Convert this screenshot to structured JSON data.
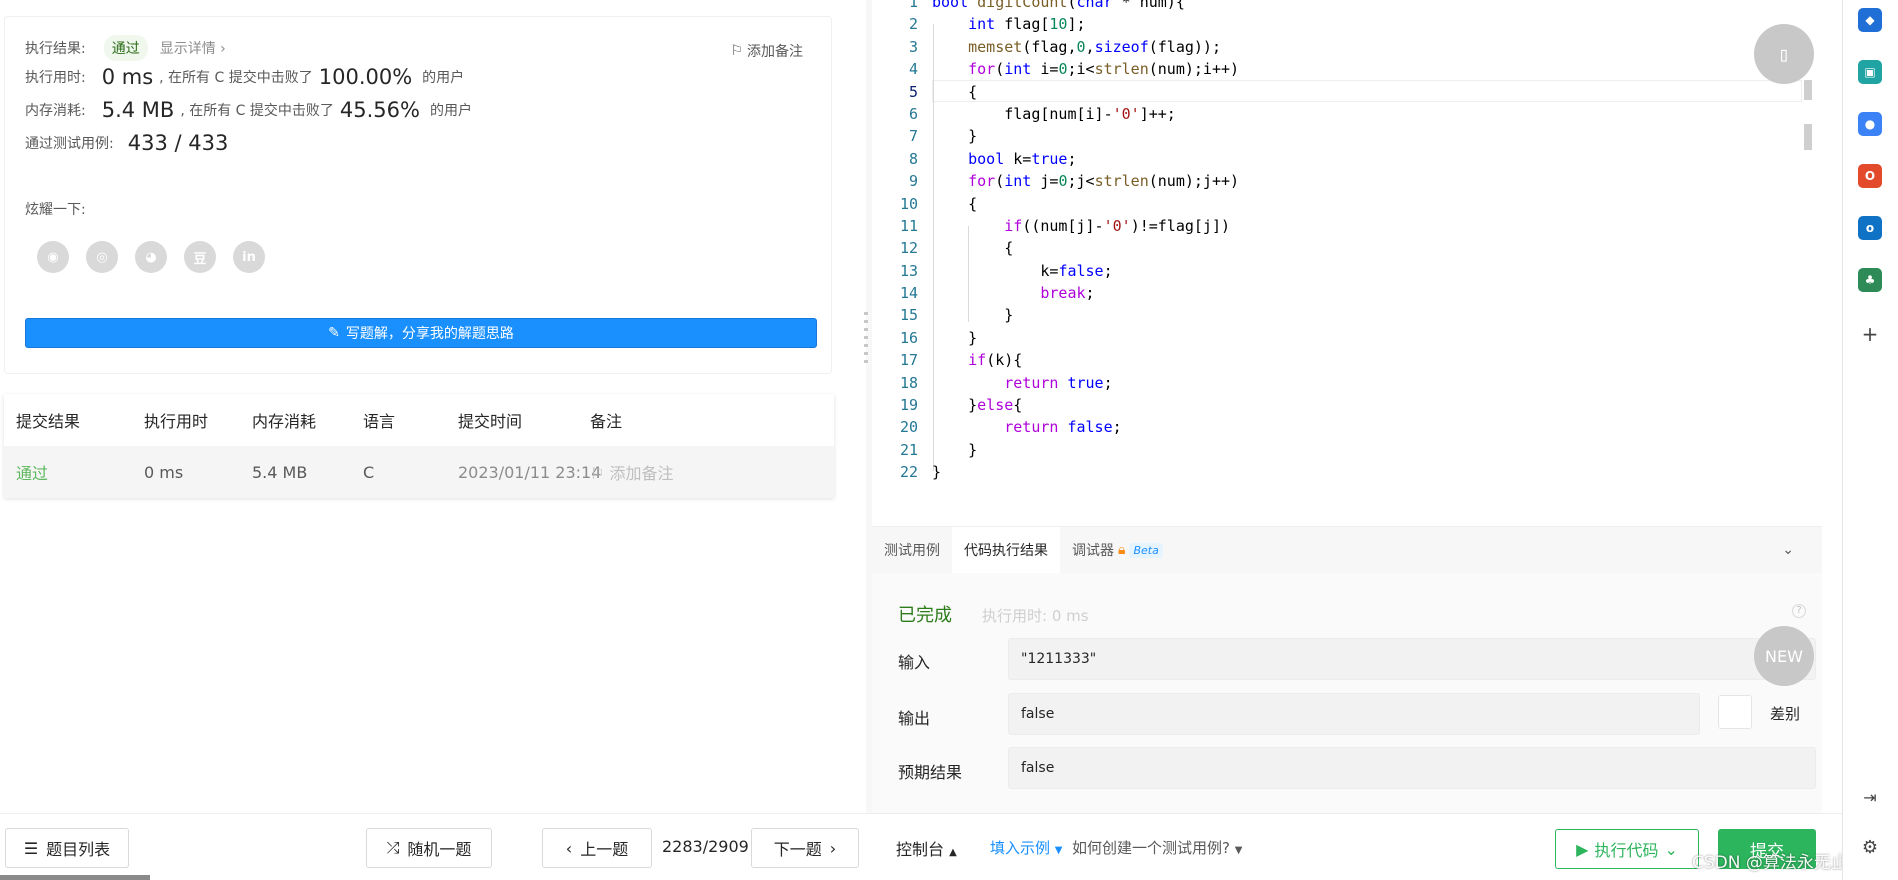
{
  "result": {
    "exec_label": "执行结果:",
    "status": "通过",
    "details": "显示详情 ›",
    "add_note": "添加备注",
    "time_label": "执行用时:",
    "time_value": "0 ms",
    "beat_prefix": ", 在所有 C 提交中击败了",
    "time_percent": "100.00%",
    "users_suffix": "的用户",
    "mem_label": "内存消耗:",
    "mem_value": "5.4 MB",
    "mem_percent": "45.56%",
    "cases_label": "通过测试用例:",
    "cases_value": "433 / 433",
    "share_label": "炫耀一下:",
    "share_icons": [
      "wechat-icon",
      "weibo-icon",
      "qq-icon",
      "douban-icon",
      "linkedin-icon"
    ],
    "share_glyphs": [
      "◉",
      "◎",
      "◕",
      "豆",
      "in"
    ],
    "write_solution": "写题解，分享我的解题思路"
  },
  "submissions": {
    "headers": [
      "提交结果",
      "执行用时",
      "内存消耗",
      "语言",
      "提交时间",
      "备注"
    ],
    "row": {
      "status": "通过",
      "time": "0 ms",
      "memory": "5.4 MB",
      "language": "C",
      "submitted": "2023/01/11 23:14",
      "note": "添加备注"
    }
  },
  "editor": {
    "line_numbers": [
      "1",
      "2",
      "3",
      "4",
      "5",
      "6",
      "7",
      "8",
      "9",
      "10",
      "11",
      "12",
      "13",
      "14",
      "15",
      "16",
      "17",
      "18",
      "19",
      "20",
      "21",
      "22"
    ],
    "current_line": 5
  },
  "console": {
    "tabs": [
      "测试用例",
      "代码执行结果",
      "调试器"
    ],
    "active_tab": 1,
    "beta": "Beta",
    "status": "已完成",
    "exec_time": "执行用时: 0 ms",
    "input_label": "输入",
    "input_value": "\"1211333\"",
    "output_label": "输出",
    "output_value": "false",
    "diff_label": "差别",
    "expected_label": "预期结果",
    "expected_value": "false",
    "new_badge": "NEW"
  },
  "bottom": {
    "problem_list": "题目列表",
    "random": "随机一题",
    "prev": "上一题",
    "pager": "2283/2909",
    "next": "下一题",
    "console": "控制台",
    "fill_example": "填入示例",
    "how_to": "如何创建一个测试用例?",
    "run": "执行代码",
    "submit": "提交",
    "watermark": "CSDN @算法永无止境"
  },
  "sidebar": {
    "icons": [
      "tag-icon",
      "briefcase-icon",
      "people-icon",
      "office-icon",
      "outlook-icon",
      "tree-icon",
      "add-icon"
    ],
    "colors": [
      "#1f6fd6",
      "#1fa3a3",
      "#3b82f6",
      "#e24a2b",
      "#0f72c5",
      "#2e8b57"
    ],
    "bottom_icons": [
      "exit-panel-icon",
      "settings-icon"
    ]
  },
  "colors": {
    "accent_blue": "#1a90ff",
    "pass_green": "#2d7d1b",
    "submit_green": "#2db55d"
  }
}
